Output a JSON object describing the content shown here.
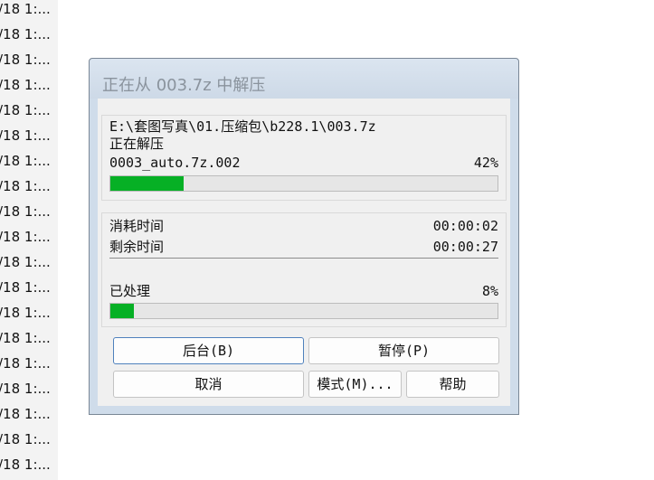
{
  "background_list": {
    "rows": [
      "/18 1:...",
      "/18 1:...",
      "/18 1:...",
      "/18 1:...",
      "/18 1:...",
      "/18 1:...",
      "/18 1:...",
      "/18 1:...",
      "/18 1:...",
      "/18 1:...",
      "/18 1:...",
      "/18 1:...",
      "/18 1:...",
      "/18 1:...",
      "/18 1:...",
      "/18 1:...",
      "/18 1:...",
      "/18 1:...",
      "/18 1:..."
    ]
  },
  "dialog": {
    "title": "正在从 003.7z 中解压",
    "file_path": "E:\\套图写真\\01.压缩包\\b228.1\\003.7z",
    "status": "正在解压",
    "current_file": "0003_auto.7z.002",
    "file_percent_label": "42%",
    "file_progress": 0.19,
    "elapsed_label": "消耗时间",
    "elapsed_value": "00:00:02",
    "remaining_label": "剩余时间",
    "remaining_value": "00:00:27",
    "processed_label": "已处理",
    "processed_percent_label": "8%",
    "total_progress": 0.06,
    "buttons": {
      "background": "后台(B)",
      "pause": "暂停(P)",
      "cancel": "取消",
      "mode": "模式(M)...",
      "help": "帮助"
    },
    "progress_color": "#06b025"
  }
}
